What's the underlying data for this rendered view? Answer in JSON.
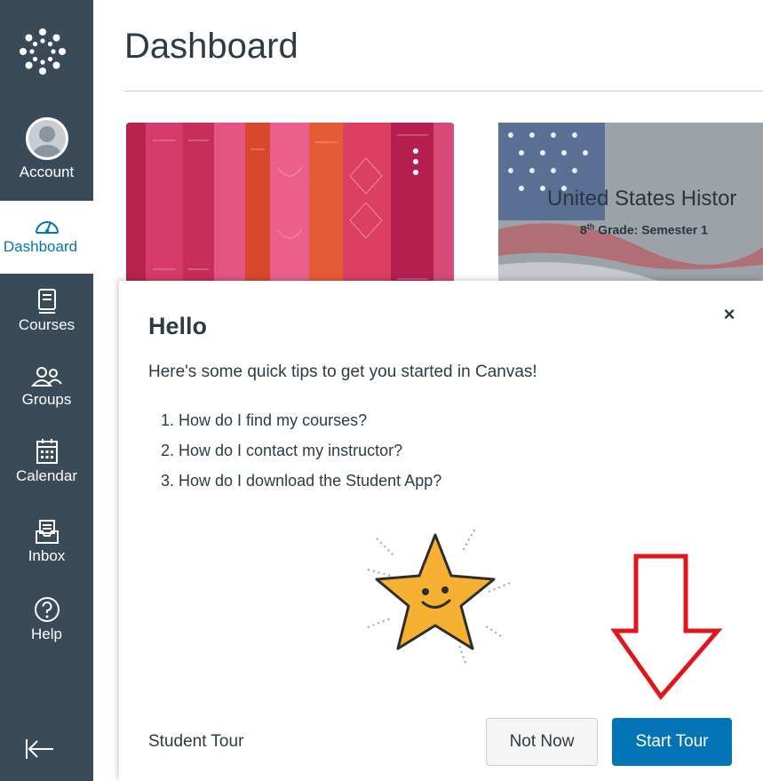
{
  "nav": {
    "items": [
      {
        "label": "Account"
      },
      {
        "label": "Dashboard"
      },
      {
        "label": "Courses"
      },
      {
        "label": "Groups"
      },
      {
        "label": "Calendar"
      },
      {
        "label": "Inbox"
      },
      {
        "label": "Help"
      }
    ],
    "active_item": "Dashboard",
    "icons": [
      "canvas-logo-icon",
      "avatar-icon",
      "dashboard-icon",
      "courses-icon",
      "groups-icon",
      "calendar-icon",
      "inbox-icon",
      "help-icon",
      "collapse-nav-icon"
    ]
  },
  "header": {
    "title": "Dashboard"
  },
  "courses": {
    "cards": [
      {
        "image_title": "",
        "image_subtitle": ""
      },
      {
        "image_title": "United States Histor",
        "image_subtitle_prefix": "8",
        "image_subtitle_sup": "th",
        "image_subtitle_rest": " Grade: Semester 1"
      }
    ]
  },
  "modal": {
    "title": "Hello",
    "intro": "Here's some quick tips to get you started in Canvas!",
    "tips": [
      "1. How do I find my courses?",
      "2. How do I contact my instructor?",
      "3. How do I download the Student App?"
    ],
    "footer_label": "Student Tour",
    "close_label": "×",
    "not_now_label": "Not Now",
    "start_tour_label": "Start Tour"
  },
  "colors": {
    "nav_bg": "#394b58",
    "primary": "#0374b5",
    "arrow": "#e0161d",
    "star": "#f6b133"
  }
}
